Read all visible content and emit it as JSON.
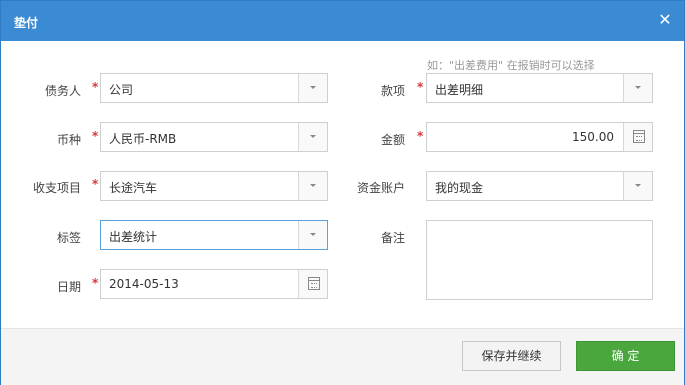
{
  "dialog": {
    "title": "垫付",
    "close_icon": "close-icon"
  },
  "hint": "如：\"出差费用\" 在报销时可以选择",
  "form": {
    "debtor": {
      "label": "债务人",
      "value": "公司"
    },
    "currency": {
      "label": "币种",
      "value": "人民币-RMB"
    },
    "category": {
      "label": "收支项目",
      "value": "长途汽车"
    },
    "tag": {
      "label": "标签",
      "value": "出差统计"
    },
    "date": {
      "label": "日期",
      "value": "2014-05-13"
    },
    "item": {
      "label": "款项",
      "value": "出差明细"
    },
    "amount": {
      "label": "金额",
      "value": "150.00"
    },
    "account": {
      "label": "资金账户",
      "value": "我的现金"
    },
    "note": {
      "label": "备注",
      "value": ""
    },
    "required_mark": "*"
  },
  "footer": {
    "save_continue_label": "保存并继续",
    "confirm_label": "确 定"
  },
  "colors": {
    "title_bar": "#3a8bd3",
    "confirm_button": "#4aa73e",
    "required_mark": "#d9363e"
  }
}
